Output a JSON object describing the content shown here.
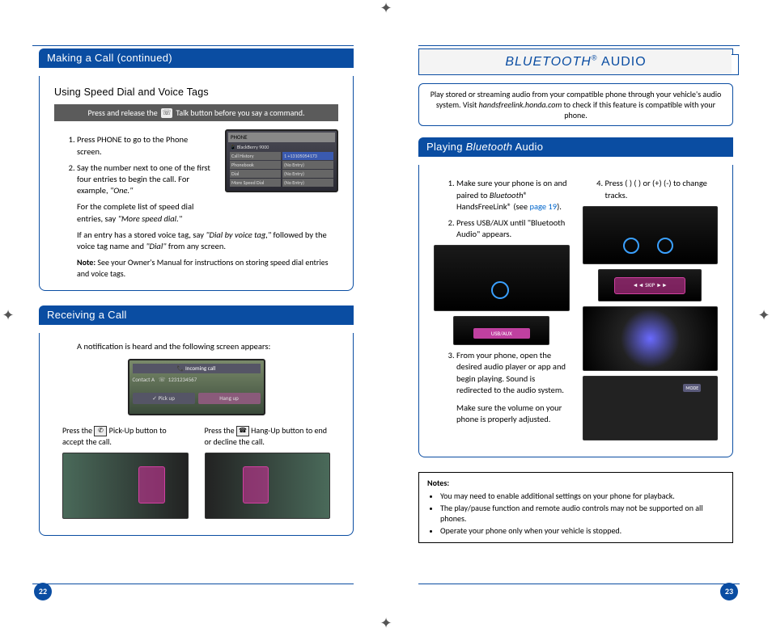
{
  "left": {
    "section1_header": "Making a Call (continued)",
    "subhead": "Using Speed Dial and Voice Tags",
    "tip_pre": "Press and release the",
    "tip_post": "Talk button before you say a command.",
    "step1": "Press PHONE to go to the Phone screen.",
    "step2_a": "Say the number next to one of the first four entries to begin the call. For example, ",
    "step2_b": "\"One.\"",
    "step_extra_a": "For the complete list of speed dial entries, say ",
    "step_extra_b": "\"More speed dial.\"",
    "voice_tag_a": "If an entry has a stored voice tag, say ",
    "voice_tag_b": "\"Dial by voice tag,\"",
    "voice_tag_c": " followed by the voice tag name and ",
    "voice_tag_d": "\"Dial\"",
    "voice_tag_e": " from any screen.",
    "note_label": "Note:",
    "note_text": " See your Owner's Manual for instructions on storing speed dial entries and voice tags.",
    "phone_screen": {
      "title": "PHONE",
      "device": "BlackBerry 9000",
      "rows": [
        "Call History",
        "Phonebook",
        "Dial",
        "More Speed Dial"
      ],
      "entry": "1 +13105054173",
      "noentry": "(No Entry)"
    },
    "section2_header": "Receiving a Call",
    "receiving_intro": "A notification is heard and the following screen appears:",
    "incoming": {
      "label": "Incoming call",
      "contact": "Contact A",
      "number": "1231234567",
      "pickup": "Pick up",
      "hangup": "Hang up"
    },
    "pickup_a": "Press the ",
    "pickup_b": " Pick-Up button to accept the call.",
    "hangup_a": "Press the ",
    "hangup_b": " Hang-Up button to end or decline the call.",
    "page_num": "22"
  },
  "right": {
    "title_a": "BLUETOOTH",
    "title_reg": "®",
    "title_b": " AUDIO",
    "intro_a": "Play stored or streaming audio from your compatible phone through your vehicle's audio system. Visit ",
    "intro_site": "handsfreelink.honda.com",
    "intro_b": " to check if this feature is compatible with your phone.",
    "section_header_a": "Playing ",
    "section_header_b": "Bluetooth",
    "section_header_c": " Audio",
    "step1_a": "Make sure your phone is on and paired to ",
    "step1_b": "Bluetooth",
    "step1_c": "® HandsFreeLink® (see ",
    "step1_link": "page 19",
    "step1_d": ").",
    "step2": "Press USB/AUX until \"Bluetooth Audio\" appears.",
    "step3_a": "From your phone, open the desired audio player or app and begin playing. Sound is redirected to the audio system.",
    "step3_b": "Make sure the volume on your phone is properly adjusted.",
    "step4": "Press (  ) (  ) or (+) (-) to change tracks.",
    "skip_label": "SKIP",
    "usb_label": "USB/AUX",
    "notes_label": "Notes:",
    "note1": "You may need to enable additional settings on your phone for playback.",
    "note2": "The play/pause function and remote audio controls may not be supported on all phones.",
    "note3": "Operate your phone only when your vehicle is stopped.",
    "page_num": "23"
  }
}
